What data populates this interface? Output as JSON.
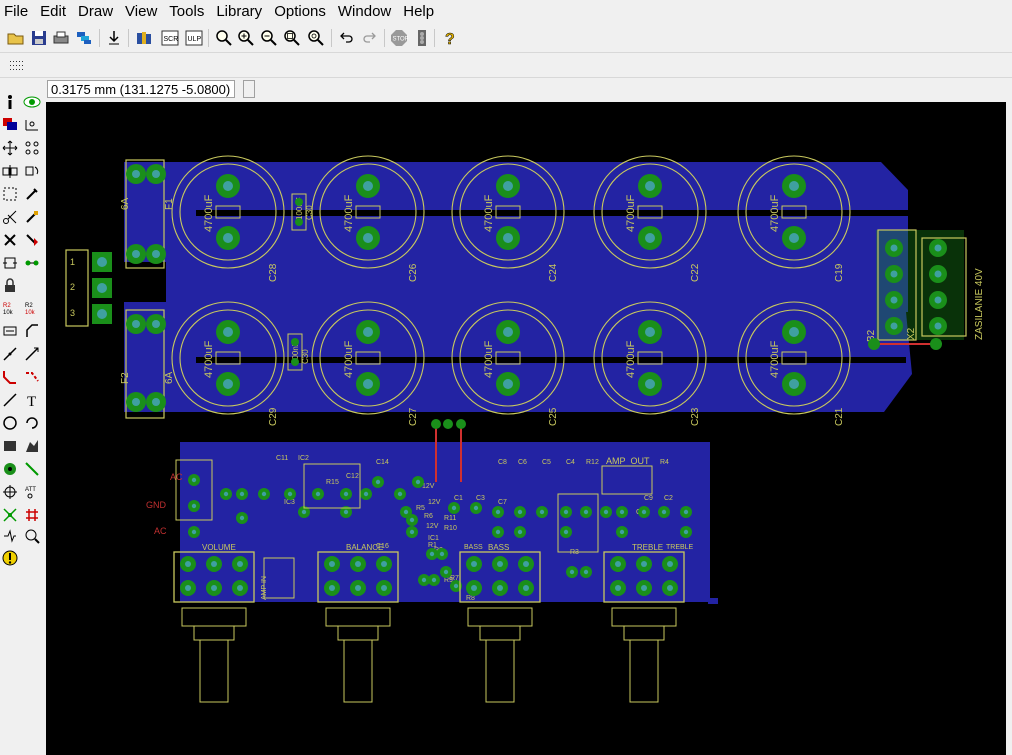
{
  "menu": [
    "File",
    "Edit",
    "Draw",
    "View",
    "Tools",
    "Library",
    "Options",
    "Window",
    "Help"
  ],
  "status": {
    "coordinates": "0.3175 mm (131.1275 -5.0800)"
  },
  "toolbar": {
    "buttons": [
      "open-icon",
      "save-icon",
      "print-icon",
      "layers-icon",
      "import-icon",
      "library-icon",
      "script-icon",
      "ulp-icon",
      "zoom-fit-icon",
      "zoom-in-icon",
      "zoom-out-icon",
      "zoom-select-icon",
      "zoom-redraw-icon",
      "undo-icon",
      "redo-icon",
      "stop-icon",
      "go-icon",
      "help-icon"
    ]
  },
  "board": {
    "capacitors_top": [
      {
        "name": "C28",
        "value": "4700uF"
      },
      {
        "name": "C26",
        "value": "4700uF"
      },
      {
        "name": "C24",
        "value": "4700uF"
      },
      {
        "name": "C22",
        "value": "4700uF"
      },
      {
        "name": "C19",
        "value": "4700uF"
      }
    ],
    "capacitors_bottom": [
      {
        "name": "C29",
        "value": "4700uF"
      },
      {
        "name": "C27",
        "value": "4700uF"
      },
      {
        "name": "C25",
        "value": "4700uF"
      },
      {
        "name": "C23",
        "value": "4700uF"
      },
      {
        "name": "C21",
        "value": "4700uF"
      }
    ],
    "small_caps": [
      "C30",
      "C30"
    ],
    "small_cap_values": [
      "100nF",
      "100nF"
    ],
    "fuses": [
      {
        "name": "F1",
        "rating": "6A"
      },
      {
        "name": "F2",
        "rating": "6A"
      }
    ],
    "power_connector": {
      "label": "ZASILANIE 40V",
      "name": "X2"
    },
    "bridge": "B2",
    "out_pins": [
      "1",
      "2",
      "3"
    ],
    "pots": [
      "VOLUME",
      "BALANCE",
      "BASS",
      "TREBLE"
    ],
    "audio_labels": {
      "amp_out": "AMP_OUT",
      "amp_in": "AMP IN",
      "ac": "AC",
      "gnd": "GND"
    },
    "tone_parts": [
      "C11",
      "IC2",
      "C14",
      "C12",
      "C8",
      "C6",
      "C5",
      "C4",
      "R12",
      "R4",
      "C1",
      "C3",
      "C9",
      "C2",
      "IC3",
      "R15",
      "C16",
      "C7",
      "R3",
      "IC1",
      "R11",
      "R10",
      "R2",
      "R7",
      "R8"
    ],
    "misc_labels": [
      "12V",
      "12V",
      "12V",
      "BASS",
      "TREBLE",
      "R1",
      "R5",
      "R6",
      "R9",
      "C10"
    ]
  }
}
